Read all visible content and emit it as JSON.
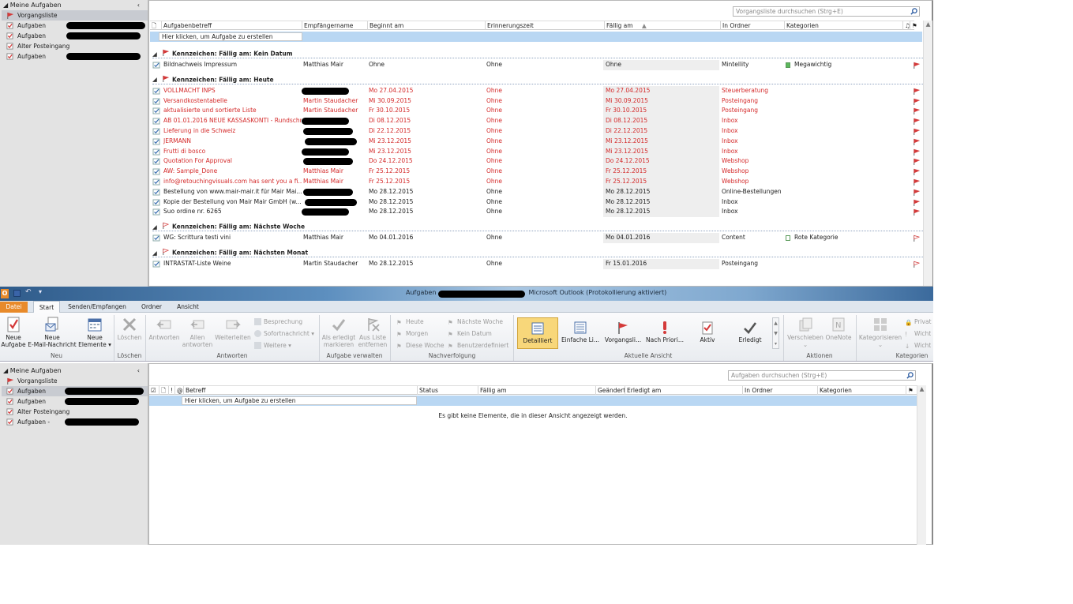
{
  "top": {
    "nav": {
      "header": "Meine Aufgaben",
      "items": [
        {
          "label": "Vorgangsliste",
          "selected": true,
          "icon": "flag-icon",
          "redacted": false
        },
        {
          "label": "Aufgaben",
          "selected": false,
          "icon": "tasks-icon",
          "redacted": true
        },
        {
          "label": "Aufgaben",
          "selected": false,
          "icon": "tasks-icon",
          "redacted": true
        },
        {
          "label": "Alter Posteingang",
          "selected": false,
          "icon": "tasks-icon",
          "redacted": false
        },
        {
          "label": "Aufgaben",
          "selected": false,
          "icon": "tasks-icon",
          "redacted": true
        }
      ]
    },
    "search_placeholder": "Vorgangsliste durchsuchen (Strg+E)",
    "columns": [
      "Aufgabenbetreff",
      "Empfängername",
      "Beginnt am",
      "Erinnerungszeit",
      "Fällig am",
      "In Ordner",
      "Kategorien"
    ],
    "new_task_text": "Hier klicken, um Aufgabe zu erstellen",
    "groups": [
      {
        "title": "Kennzeichen: Fällig am: Kein Datum",
        "rows": [
          {
            "subject": "Bildnachweis Impressum",
            "recipient": "Matthias Mair",
            "start": "Ohne",
            "reminder": "Ohne",
            "due": "Ohne",
            "folder": "Mintellity",
            "category": "Megawichtig",
            "category_color": "#5cb85c",
            "overdue": false,
            "redacted": false
          }
        ]
      },
      {
        "title": "Kennzeichen: Fällig am: Heute",
        "rows": [
          {
            "subject": "VOLLMACHT INPS",
            "recipient": "",
            "start": "Mo 27.04.2015",
            "reminder": "Ohne",
            "due": "Mo 27.04.2015",
            "folder": "Steuerberatung",
            "category": "",
            "overdue": true,
            "redacted": true
          },
          {
            "subject": "Versandkostentabelle",
            "recipient": "Martin Staudacher",
            "start": "Mi 30.09.2015",
            "reminder": "Ohne",
            "due": "Mi 30.09.2015",
            "folder": "Posteingang",
            "category": "",
            "overdue": true,
            "redacted": false
          },
          {
            "subject": "aktualisierte und sortierte Liste",
            "recipient": "Martin Staudacher",
            "start": "Fr 30.10.2015",
            "reminder": "Ohne",
            "due": "Fr 30.10.2015",
            "folder": "Posteingang",
            "category": "",
            "overdue": true,
            "redacted": false
          },
          {
            "subject": "AB 01.01.2016 NEUE KASSASKONTI - Rundschr...",
            "recipient": "",
            "start": "Di 08.12.2015",
            "reminder": "Ohne",
            "due": "Di 08.12.2015",
            "folder": "Inbox",
            "category": "",
            "overdue": true,
            "redacted": true
          },
          {
            "subject": "Lieferung in die Schweiz",
            "recipient": "",
            "start": "Di 22.12.2015",
            "reminder": "Ohne",
            "due": "Di 22.12.2015",
            "folder": "Inbox",
            "category": "",
            "overdue": true,
            "redacted": true
          },
          {
            "subject": "JERMANN",
            "recipient": "",
            "start": "Mi 23.12.2015",
            "reminder": "Ohne",
            "due": "Mi 23.12.2015",
            "folder": "Inbox",
            "category": "",
            "overdue": true,
            "redacted": true
          },
          {
            "subject": "Frutti di bosco",
            "recipient": "",
            "start": "Mi 23.12.2015",
            "reminder": "Ohne",
            "due": "Mi 23.12.2015",
            "folder": "Inbox",
            "category": "",
            "overdue": true,
            "redacted": true
          },
          {
            "subject": "Quotation For Approval",
            "recipient": "",
            "start": "Do 24.12.2015",
            "reminder": "Ohne",
            "due": "Do 24.12.2015",
            "folder": "Webshop",
            "category": "",
            "overdue": true,
            "redacted": true
          },
          {
            "subject": "AW: Sample_Done",
            "recipient": "Matthias Mair",
            "start": "Fr 25.12.2015",
            "reminder": "Ohne",
            "due": "Fr 25.12.2015",
            "folder": "Webshop",
            "category": "",
            "overdue": true,
            "redacted": false
          },
          {
            "subject": "info@retouchingvisuals.com has sent you a fi...",
            "recipient": "Matthias Mair",
            "start": "Fr 25.12.2015",
            "reminder": "Ohne",
            "due": "Fr 25.12.2015",
            "folder": "Webshop",
            "category": "",
            "overdue": true,
            "redacted": false
          },
          {
            "subject": "Bestellung von www.mair-mair.it für Mair Mai...",
            "recipient": "",
            "start": "Mo 28.12.2015",
            "reminder": "Ohne",
            "due": "Mo 28.12.2015",
            "folder": "Online-Bestellungen",
            "category": "",
            "overdue": false,
            "redacted": true
          },
          {
            "subject": "Kopie der Bestellung von Mair Mair GmbH (w...",
            "recipient": "",
            "start": "Mo 28.12.2015",
            "reminder": "Ohne",
            "due": "Mo 28.12.2015",
            "folder": "Inbox",
            "category": "",
            "overdue": false,
            "redacted": true
          },
          {
            "subject": "Suo ordine nr. 6265",
            "recipient": "",
            "start": "Mo 28.12.2015",
            "reminder": "Ohne",
            "due": "Mo 28.12.2015",
            "folder": "Inbox",
            "category": "",
            "overdue": false,
            "redacted": true
          }
        ]
      },
      {
        "title": "Kennzeichen: Fällig am: Nächste Woche",
        "rows": [
          {
            "subject": "WG: Scrittura testi vini",
            "recipient": "Matthias Mair",
            "start": "Mo 04.01.2016",
            "reminder": "Ohne",
            "due": "Mo 04.01.2016",
            "folder": "Content",
            "category": "Rote Kategorie",
            "category_color": "#ffffff",
            "overdue": false,
            "redacted": false
          }
        ]
      },
      {
        "title": "Kennzeichen: Fällig am: Nächsten Monat",
        "rows": [
          {
            "subject": "INTRASTAT-Liste Weine",
            "recipient": "Martin Staudacher",
            "start": "Mo 28.12.2015",
            "reminder": "Ohne",
            "due": "Fr 15.01.2016",
            "folder": "Posteingang",
            "category": "",
            "overdue": false,
            "redacted": false
          }
        ]
      }
    ]
  },
  "window": {
    "title_left": "Aufgaben",
    "title_right": "Microsoft Outlook (Protokollierung aktiviert)"
  },
  "tabs": [
    "Datei",
    "Start",
    "Senden/Empfangen",
    "Ordner",
    "Ansicht"
  ],
  "ribbon": {
    "groups": {
      "neu": "Neu",
      "loeschen": "Löschen",
      "antworten": "Antworten",
      "verwalten": "Aufgabe verwalten",
      "nachverfolgung": "Nachverfolgung",
      "ansicht": "Aktuelle Ansicht",
      "aktionen": "Aktionen",
      "kategorien": "Kategorien"
    },
    "neue_aufgabe": [
      "Neue",
      "Aufgabe"
    ],
    "neue_email": [
      "Neue",
      "E-Mail-Nachricht"
    ],
    "neue_elemente": [
      "Neue",
      "Elemente ▾"
    ],
    "loeschen": "Löschen",
    "antworten": "Antworten",
    "allen_antworten": [
      "Allen",
      "antworten"
    ],
    "weiterleiten": "Weiterleiten",
    "besprechung": "Besprechung",
    "sofortnachricht": "Sofortnachricht ▾",
    "weitere": "Weitere ▾",
    "als_erledigt": [
      "Als erledigt",
      "markieren"
    ],
    "aus_liste": [
      "Aus Liste",
      "entfernen"
    ],
    "follow": [
      "Heute",
      "Morgen",
      "Diese Woche",
      "Nächste Woche",
      "Kein Datum",
      "Benutzerdefiniert"
    ],
    "views": [
      "Detailliert",
      "Einfache Li...",
      "Vorgangsli...",
      "Nach Priori...",
      "Aktiv",
      "Erledigt"
    ],
    "verschieben": "Verschieben",
    "onenote": "OneNote",
    "kategorisieren": "Kategorisieren",
    "privat": "Privat",
    "wichtig1": "Wicht",
    "wichtig2": "Wicht"
  },
  "bottom": {
    "nav": {
      "header": "Meine Aufgaben",
      "items": [
        {
          "label": "Vorgangsliste",
          "selected": false,
          "icon": "flag-icon",
          "redacted": false
        },
        {
          "label": "Aufgaben",
          "selected": true,
          "icon": "tasks-icon",
          "redacted": true
        },
        {
          "label": "Aufgaben",
          "selected": false,
          "icon": "tasks-icon",
          "redacted": true
        },
        {
          "label": "Alter Posteingang",
          "selected": false,
          "icon": "tasks-icon",
          "redacted": false
        },
        {
          "label": "Aufgaben -",
          "selected": false,
          "icon": "tasks-icon",
          "redacted": true
        }
      ]
    },
    "search_placeholder": "Aufgaben durchsuchen (Strg+E)",
    "columns": [
      "Betreff",
      "Status",
      "Fällig am",
      "Geändert",
      "Erledigt am",
      "In Ordner",
      "Kategorien"
    ],
    "new_task_text": "Hier klicken, um Aufgabe zu erstellen",
    "empty_text": "Es gibt keine Elemente, die in dieser Ansicht angezeigt werden."
  },
  "colors": {
    "accent": "#e88a2a",
    "overdue": "#d42a2a",
    "selection": "#b9d7f3",
    "view_active": "#f8d77a"
  }
}
